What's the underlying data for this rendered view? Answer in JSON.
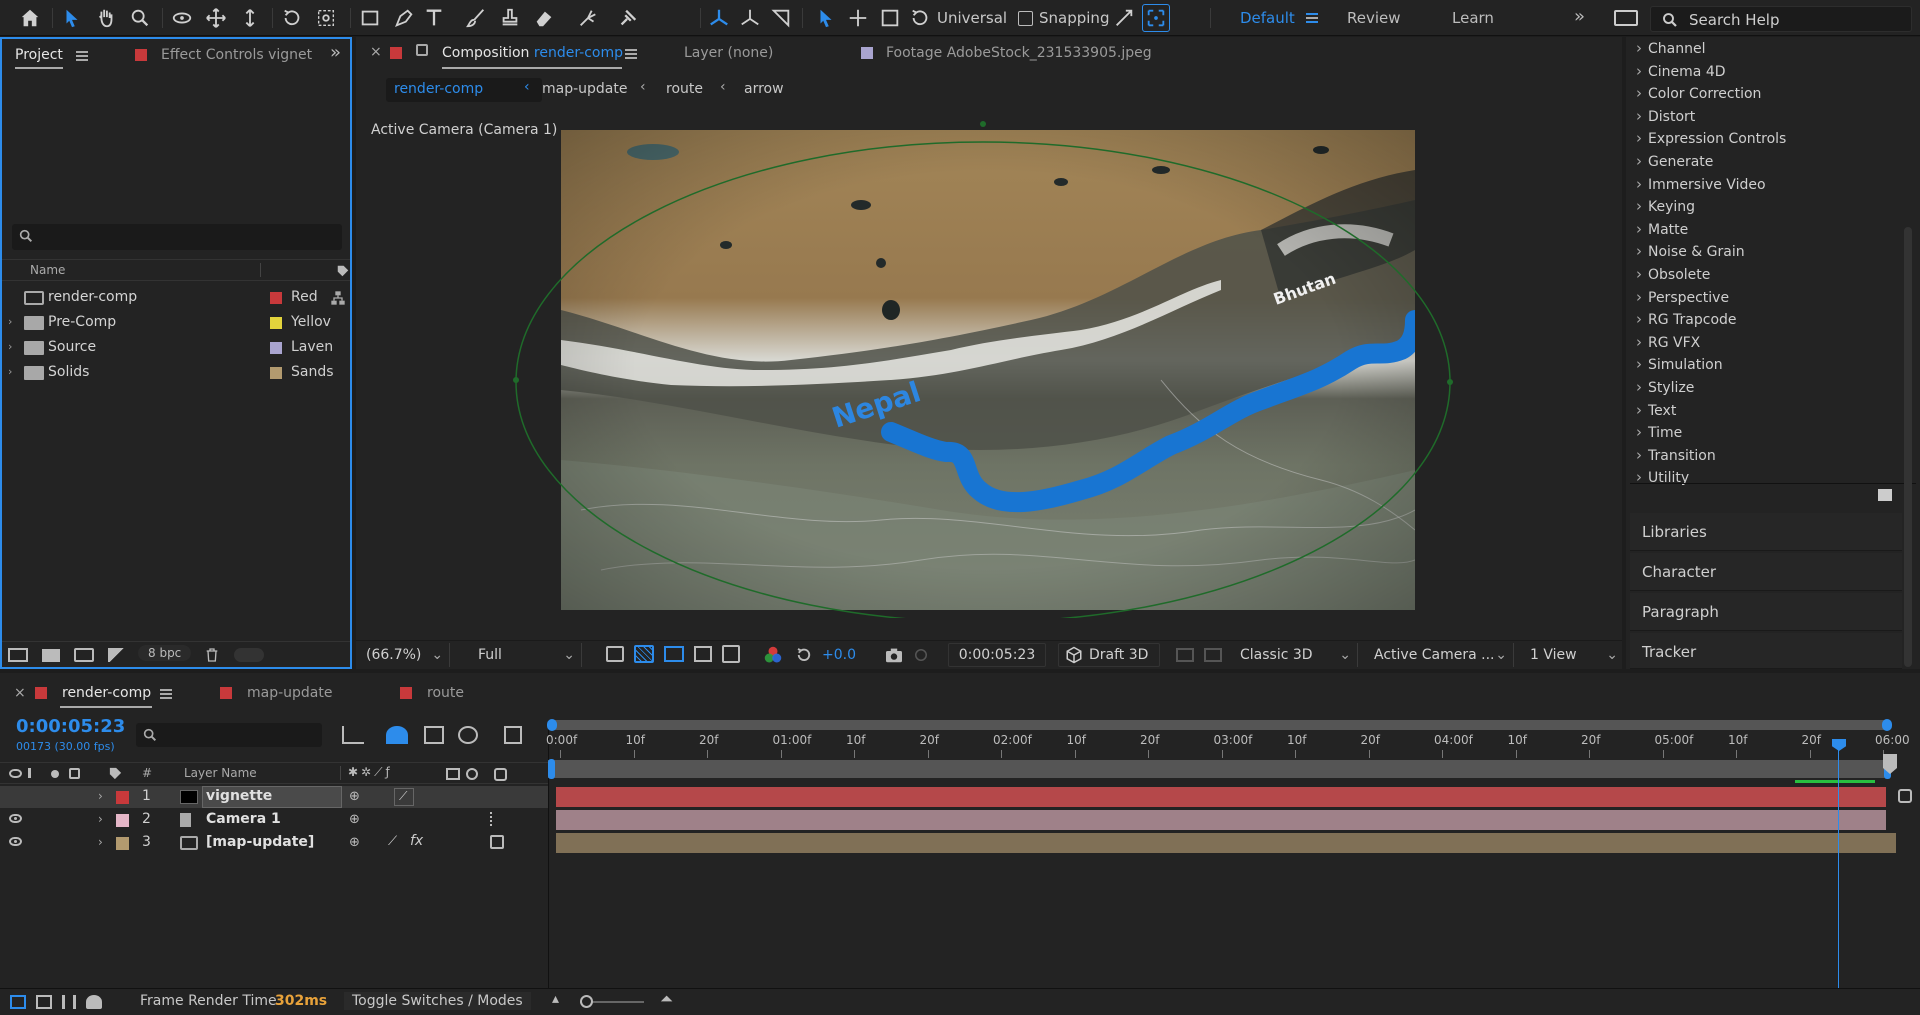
{
  "toolbar": {
    "axis_mode": "Universal",
    "snapping": "Snapping",
    "workspaces": [
      {
        "label": "Default",
        "active": true
      },
      {
        "label": "Review",
        "active": false
      },
      {
        "label": "Learn",
        "active": false
      }
    ],
    "search_placeholder": "Search Help"
  },
  "project": {
    "tab_label": "Project",
    "effect_controls_label": "Effect Controls vignet",
    "column_name": "Name",
    "bit_depth": "8 bpc",
    "items": [
      {
        "name": "render-comp",
        "color": "#c8393b",
        "label": "Red",
        "type": "comp"
      },
      {
        "name": "Pre-Comp",
        "color": "#e3d43c",
        "label": "Yellov",
        "type": "folder"
      },
      {
        "name": "Source",
        "color": "#a9a4cf",
        "label": "Laven",
        "type": "folder"
      },
      {
        "name": "Solids",
        "color": "#b29a6f",
        "label": "Sands",
        "type": "folder"
      }
    ]
  },
  "composition": {
    "tab_prefix": "Composition",
    "tab_name": "render-comp",
    "layer_tab": "Layer (none)",
    "footage_tab": "Footage AdobeStock_231533905.jpeg",
    "breadcrumbs": [
      "render-comp",
      "map-update",
      "route",
      "arrow"
    ],
    "camera_label": "Active Camera (Camera 1)",
    "map_labels": {
      "nepal": "Nepal",
      "bhutan": "Bhutan"
    },
    "viewer_bar": {
      "zoom": "(66.7%)",
      "resolution": "Full",
      "exposure": "+0.0",
      "timecode": "0:00:05:23",
      "renderer_mode": "Draft 3D",
      "renderer": "Classic 3D",
      "camera": "Active Camera ...",
      "views": "1 View"
    }
  },
  "effects": {
    "categories": [
      "Channel",
      "Cinema 4D",
      "Color Correction",
      "Distort",
      "Expression Controls",
      "Generate",
      "Immersive Video",
      "Keying",
      "Matte",
      "Noise & Grain",
      "Obsolete",
      "Perspective",
      "RG Trapcode",
      "RG VFX",
      "Simulation",
      "Stylize",
      "Text",
      "Time",
      "Transition",
      "Utility"
    ],
    "panels": [
      "Libraries",
      "Character",
      "Paragraph",
      "Tracker"
    ]
  },
  "timeline": {
    "tabs": [
      {
        "label": "render-comp",
        "active": true,
        "color": "#c8393b"
      },
      {
        "label": "map-update",
        "active": false,
        "color": "#c8393b"
      },
      {
        "label": "route",
        "active": false,
        "color": "#c8393b"
      }
    ],
    "timecode": "0:00:05:23",
    "frame_info": "00173 (30.00 fps)",
    "column_layer_name": "Layer Name",
    "column_num": "#",
    "ruler": [
      "0:00f",
      "10f",
      "20f",
      "01:00f",
      "10f",
      "20f",
      "02:00f",
      "10f",
      "20f",
      "03:00f",
      "10f",
      "20f",
      "04:00f",
      "10f",
      "20f",
      "05:00f",
      "10f",
      "20f",
      "06:00"
    ],
    "layers": [
      {
        "num": "1",
        "name": "vignette",
        "color": "#c8393b",
        "bar": "#b5484a",
        "selected": true
      },
      {
        "num": "2",
        "name": "Camera 1",
        "color": "#e4b6c7",
        "bar": "#9f8189"
      },
      {
        "num": "3",
        "name": "[map-update]",
        "color": "#b29a6f",
        "bar": "#807056"
      }
    ]
  },
  "status": {
    "render_label": "Frame Render Time",
    "render_value": "302ms",
    "toggle": "Toggle Switches / Modes"
  }
}
